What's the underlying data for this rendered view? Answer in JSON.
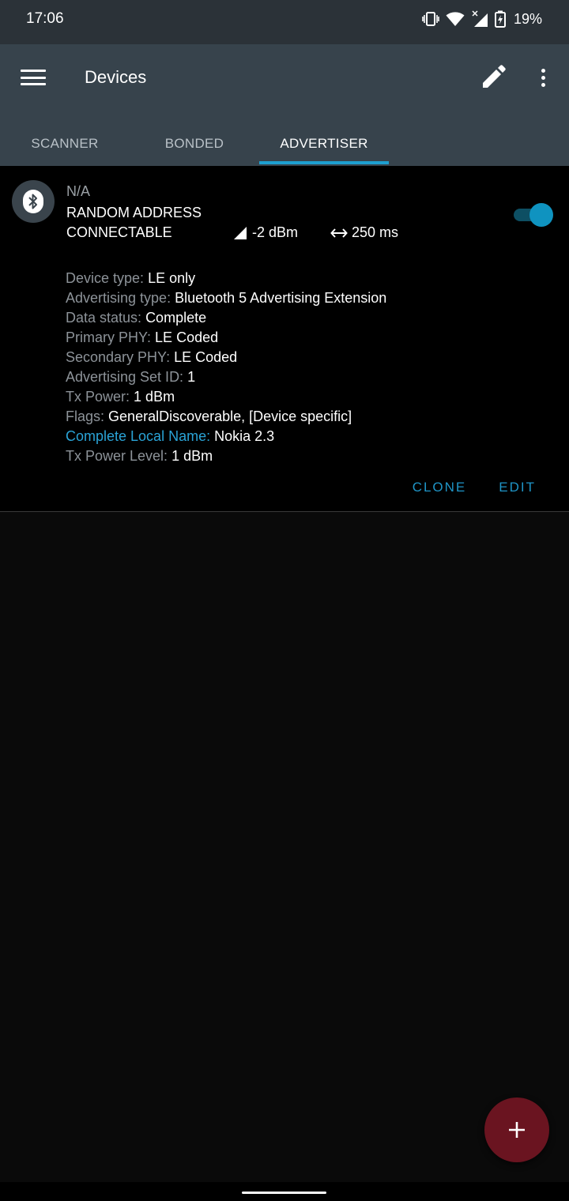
{
  "status_bar": {
    "time": "17:06",
    "battery_percent": "19%",
    "icons": [
      "vibrate-icon",
      "wifi-icon",
      "signal-icon",
      "battery-charging-icon"
    ]
  },
  "app_bar": {
    "title": "Devices",
    "icons": [
      "menu-icon",
      "pencil-icon",
      "overflow-menu-icon"
    ]
  },
  "tabs": [
    {
      "label": "SCANNER",
      "active": false
    },
    {
      "label": "BONDED",
      "active": false
    },
    {
      "label": "ADVERTISER",
      "active": true
    }
  ],
  "advertiser": {
    "name": "N/A",
    "address_type": "RANDOM ADDRESS",
    "connectable": "CONNECTABLE",
    "tx_rssi": "-2 dBm",
    "interval": "250 ms",
    "enabled": true,
    "details": [
      {
        "key": "Device type:",
        "value": "LE only"
      },
      {
        "key": "Advertising type:",
        "value": "Bluetooth 5 Advertising Extension"
      },
      {
        "key": "Data status:",
        "value": "Complete"
      },
      {
        "key": "Primary PHY:",
        "value": "LE Coded"
      },
      {
        "key": "Secondary PHY:",
        "value": "LE Coded"
      },
      {
        "key": "Advertising Set ID:",
        "value": "1"
      },
      {
        "key": "Tx Power:",
        "value": "1 dBm"
      },
      {
        "key": "Flags:",
        "value": "GeneralDiscoverable, [Device specific]"
      },
      {
        "key": "Complete Local Name:",
        "value": "Nokia 2.3",
        "highlight": true
      },
      {
        "key": "Tx Power Level:",
        "value": "1 dBm"
      }
    ],
    "actions": {
      "clone": "CLONE",
      "edit": "EDIT"
    }
  },
  "fab": {
    "icon": "plus-icon"
  },
  "colors": {
    "status_bar_bg": "#2b3238",
    "app_bar_bg": "#37434c",
    "accent": "#1e9fd0",
    "fab_bg": "#6a1420",
    "card_bg": "#000000"
  }
}
